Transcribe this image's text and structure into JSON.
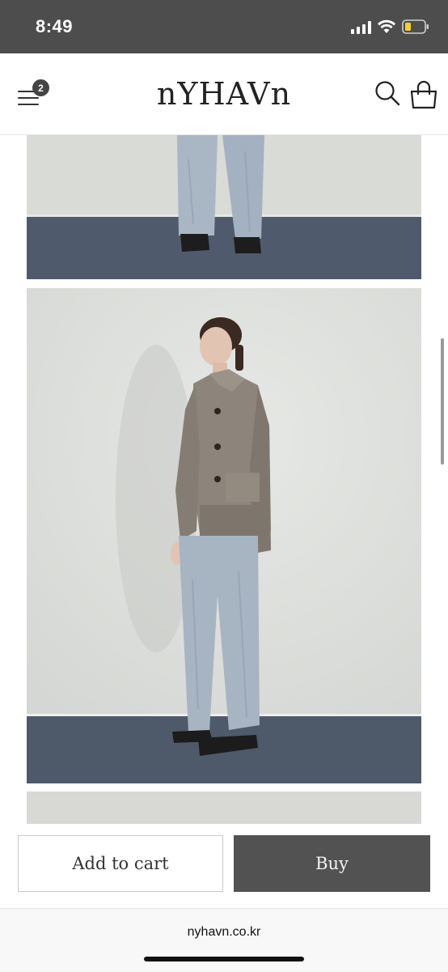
{
  "status_bar": {
    "time": "8:49",
    "icons": [
      "cellular-signal-icon",
      "wifi-icon",
      "battery-low-icon"
    ],
    "battery_color": "#f5d020"
  },
  "header": {
    "logo": "nYHAVn",
    "menu_badge_count": "2",
    "icons": [
      "hamburger-menu-icon",
      "search-icon",
      "shopping-bag-icon"
    ]
  },
  "product_gallery": {
    "images": [
      {
        "name": "jeans-detail-photo",
        "description_visible": false
      },
      {
        "name": "model-cardigan-jeans-photo",
        "description_visible": false
      },
      {
        "name": "next-photo-peek",
        "description_visible": false
      }
    ]
  },
  "actions": {
    "add_to_cart_label": "Add to cart",
    "buy_label": "Buy",
    "buy_bg": "#525252"
  },
  "browser": {
    "url": "nyhavn.co.kr"
  }
}
